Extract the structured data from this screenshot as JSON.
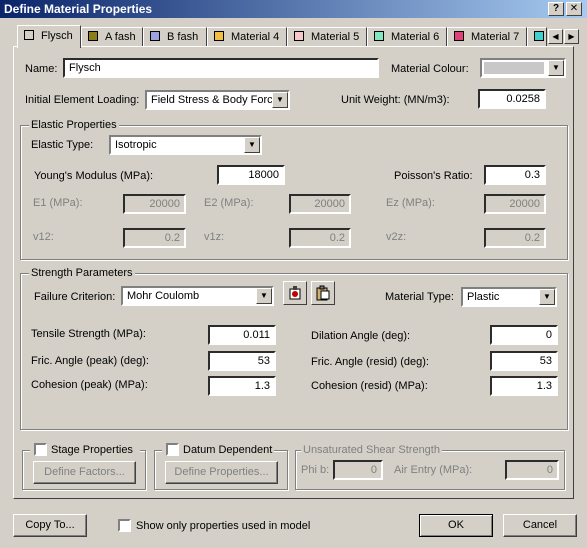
{
  "window": {
    "title": "Define Material Properties"
  },
  "tabs": [
    {
      "label": "Flysch",
      "color": "#d4d0c8"
    },
    {
      "label": "A fash",
      "color": "#8b7e1a"
    },
    {
      "label": "B fash",
      "color": "#9aa0e0"
    },
    {
      "label": "Material 4",
      "color": "#f0c040"
    },
    {
      "label": "Material 5",
      "color": "#f6c8c8"
    },
    {
      "label": "Material 6",
      "color": "#80e8c0"
    },
    {
      "label": "Material 7",
      "color": "#e0407a"
    },
    {
      "label": "",
      "color": "#40d0d0"
    }
  ],
  "general": {
    "name_label": "Name:",
    "name_value": "Flysch",
    "colour_label": "Material Colour:",
    "loading_label": "Initial Element Loading:",
    "loading_value": "Field Stress & Body Force",
    "unit_weight_label": "Unit Weight: (MN/m3):",
    "unit_weight_value": "0.0258"
  },
  "elastic": {
    "group_title": "Elastic Properties",
    "type_label": "Elastic Type:",
    "type_value": "Isotropic",
    "youngs_label": "Young's Modulus (MPa):",
    "youngs_value": "18000",
    "poisson_label": "Poisson's Ratio:",
    "poisson_value": "0.3",
    "e1_label": "E1 (MPa):",
    "e1_value": "20000",
    "e2_label": "E2 (MPa):",
    "e2_value": "20000",
    "ez_label": "Ez (MPa):",
    "ez_value": "20000",
    "v12_label": "v12:",
    "v12_value": "0.2",
    "v1z_label": "v1z:",
    "v1z_value": "0.2",
    "v2z_label": "v2z:",
    "v2z_value": "0.2"
  },
  "strength": {
    "group_title": "Strength Parameters",
    "criterion_label": "Failure Criterion:",
    "criterion_value": "Mohr Coulomb",
    "material_type_label": "Material Type:",
    "material_type_value": "Plastic",
    "tensile_label": "Tensile Strength (MPa):",
    "tensile_value": "0.011",
    "dilation_label": "Dilation Angle (deg):",
    "dilation_value": "0",
    "fric_peak_label": "Fric. Angle (peak) (deg):",
    "fric_peak_value": "53",
    "fric_resid_label": "Fric. Angle (resid) (deg):",
    "fric_resid_value": "53",
    "coh_peak_label": "Cohesion (peak) (MPa):",
    "coh_peak_value": "1.3",
    "coh_resid_label": "Cohesion (resid) (MPa):",
    "coh_resid_value": "1.3"
  },
  "stage": {
    "label": "Stage Properties",
    "button": "Define Factors..."
  },
  "datum": {
    "label": "Datum Dependent",
    "button": "Define Properties..."
  },
  "unsat": {
    "title": "Unsaturated Shear Strength",
    "phib_label": "Phi b:",
    "phib_value": "0",
    "air_label": "Air Entry (MPa):",
    "air_value": "0"
  },
  "footer": {
    "copy_button": "Copy To...",
    "show_only_label": "Show only properties used in model",
    "ok_button": "OK",
    "cancel_button": "Cancel"
  },
  "icons": {
    "help": "question-mark",
    "close": "x",
    "scroll_left": "triangle-left",
    "scroll_right": "triangle-right",
    "dropdown": "triangle-down",
    "criterion_edit": "edit-icon",
    "criterion_paste": "paste-icon"
  }
}
